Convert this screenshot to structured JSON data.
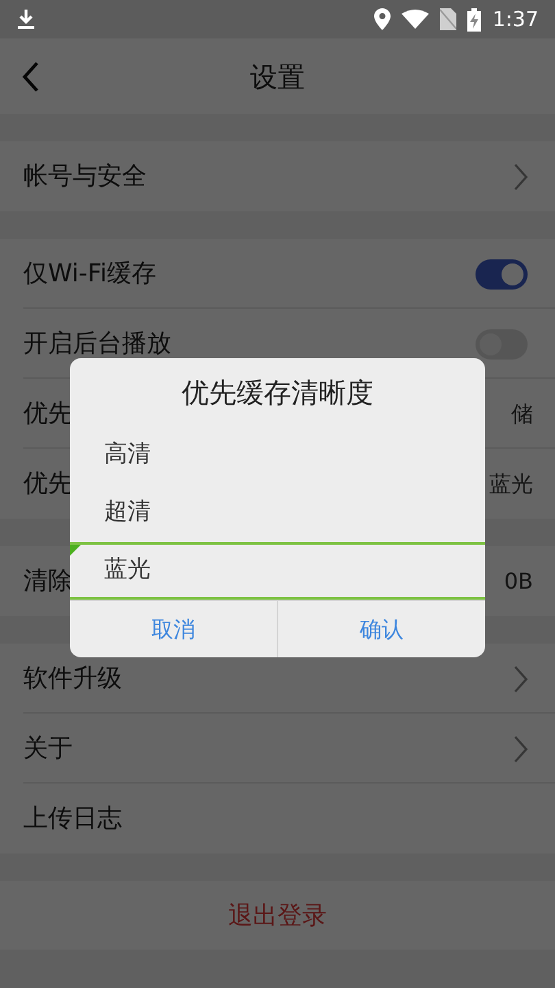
{
  "status_bar": {
    "time": "1:37"
  },
  "app_bar": {
    "title": "设置"
  },
  "groups": [
    [
      {
        "kind": "link",
        "label": "帐号与安全"
      }
    ],
    [
      {
        "kind": "toggle",
        "label": "仅Wi-Fi缓存",
        "on": true
      },
      {
        "kind": "toggle",
        "label": "开启后台播放",
        "on": false
      },
      {
        "kind": "value",
        "label": "优先",
        "value": "储"
      },
      {
        "kind": "value",
        "label": "优先",
        "value": "蓝光"
      }
    ],
    [
      {
        "kind": "value",
        "label": "清除",
        "value": "0B"
      }
    ],
    [
      {
        "kind": "link",
        "label": "软件升级"
      },
      {
        "kind": "link",
        "label": "关于"
      },
      {
        "kind": "plain",
        "label": "上传日志"
      }
    ]
  ],
  "logout": "退出登录",
  "dialog": {
    "title": "优先缓存清晰度",
    "options": [
      {
        "label": "高清",
        "selected": false
      },
      {
        "label": "超清",
        "selected": false
      },
      {
        "label": "蓝光",
        "selected": true
      }
    ],
    "buttons": [
      "取消",
      "确认"
    ]
  }
}
